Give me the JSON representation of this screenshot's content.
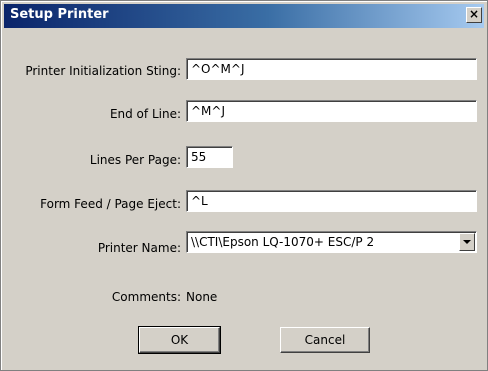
{
  "window": {
    "title": "Setup Printer",
    "close_glyph": "×"
  },
  "fields": {
    "init_string": {
      "label": "Printer Initialization Sting:",
      "value": "^O^M^J"
    },
    "end_of_line": {
      "label": "End of Line:",
      "value": "^M^J"
    },
    "lines_per_page": {
      "label": "Lines Per Page:",
      "value": "55"
    },
    "form_feed": {
      "label": "Form Feed / Page Eject:",
      "value": "^L"
    },
    "printer_name": {
      "label": "Printer Name:",
      "value": "\\\\CTI\\Epson LQ-1070+ ESC/P 2"
    },
    "comments": {
      "label": "Comments:",
      "value": "None"
    }
  },
  "buttons": {
    "ok": "OK",
    "cancel": "Cancel"
  },
  "colors": {
    "title_bar_start": "#0a246a",
    "dialog_face": "#d4d0c8"
  },
  "icons": {
    "close": "close-icon",
    "dropdown": "chevron-down-icon"
  }
}
